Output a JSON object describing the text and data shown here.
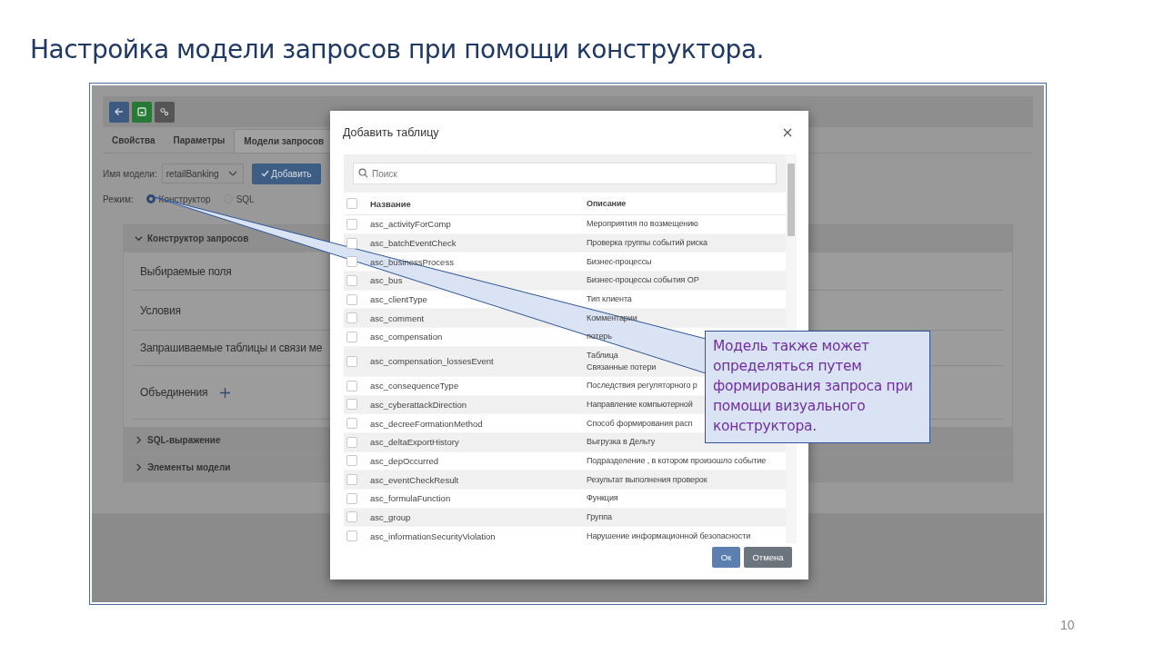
{
  "slide": {
    "title": "Настройка модели запросов при помощи конструктора.",
    "page_number": "10"
  },
  "app": {
    "toolbar_buttons": [
      {
        "kind": "back"
      },
      {
        "kind": "save"
      },
      {
        "kind": "settings"
      }
    ],
    "tabs": [
      {
        "label": "Свойства",
        "selected": false
      },
      {
        "label": "Параметры",
        "selected": false
      },
      {
        "label": "Модели запросов",
        "selected": true
      }
    ],
    "model_label": "Имя модели:",
    "model_value": "retailBanking",
    "add_button": "Добавить",
    "mode_label": "Режим:",
    "modes": [
      {
        "label": "Конструктор",
        "selected": true
      },
      {
        "label": "SQL",
        "selected": false
      }
    ],
    "sections": [
      {
        "title": "Конструктор запросов",
        "expanded": true,
        "items": [
          {
            "label": "Выбираемые поля",
            "has_add": false
          },
          {
            "label": "Условия",
            "has_add": false
          },
          {
            "label": "Запрашиваемые таблицы и связи ме",
            "has_add": false
          },
          {
            "label": "Объединения",
            "has_add": true
          }
        ]
      },
      {
        "title": "SQL-выражение",
        "expanded": false
      },
      {
        "title": "Элементы модели",
        "expanded": false
      }
    ]
  },
  "dialog": {
    "title": "Добавить таблицу",
    "search_placeholder": "Поиск",
    "columns": [
      "Название",
      "Описание"
    ],
    "all_checked": false,
    "rows": [
      {
        "name": "asc_activityForComp",
        "description": "Мероприятия по возмещению",
        "checked": false
      },
      {
        "name": "asc_batchEventCheck",
        "description": "Проверка группы событий риска",
        "checked": false
      },
      {
        "name": "asc_businessProcess",
        "description": "Бизнес-процессы",
        "checked": false
      },
      {
        "name": "asc_bus",
        "description": "Бизнес-процессы события ОР",
        "checked": false
      },
      {
        "name": "asc_clientType",
        "description": "Тип клиента",
        "checked": false
      },
      {
        "name": "asc_comment",
        "description": "Комментарии",
        "checked": false
      },
      {
        "name": "asc_compensation",
        "description": "потерь",
        "checked": false
      },
      {
        "name": "asc_compensation_lossesEvent",
        "description": "Таблица\nСвязанные потери",
        "checked": false
      },
      {
        "name": "asc_consequenceType",
        "description": "Последствия регуляторного р",
        "checked": false
      },
      {
        "name": "asc_cyberattackDirection",
        "description": "Направление компьютерной",
        "checked": false
      },
      {
        "name": "asc_decreeFormationMethod",
        "description": "Способ формирования расп",
        "checked": false
      },
      {
        "name": "asc_deltaExportHistory",
        "description": "Выгрузка в Дельту",
        "checked": false
      },
      {
        "name": "asc_depOccurred",
        "description": "Подразделение , в котором произошло событие",
        "checked": false
      },
      {
        "name": "asc_eventCheckResult",
        "description": "Результат выполнения проверок",
        "checked": false
      },
      {
        "name": "asc_formulaFunction",
        "description": "Функция",
        "checked": false
      },
      {
        "name": "asc_group",
        "description": "Группа",
        "checked": false
      },
      {
        "name": "asc_informationSecurityViolation",
        "description": "Нарушение информационной безопасности",
        "checked": false
      }
    ],
    "ok_button": "Ок",
    "cancel_button": "Отмена"
  },
  "callout": {
    "text": "Модель также может определяться путем формирования запроса при помощи визуального конструктора."
  }
}
